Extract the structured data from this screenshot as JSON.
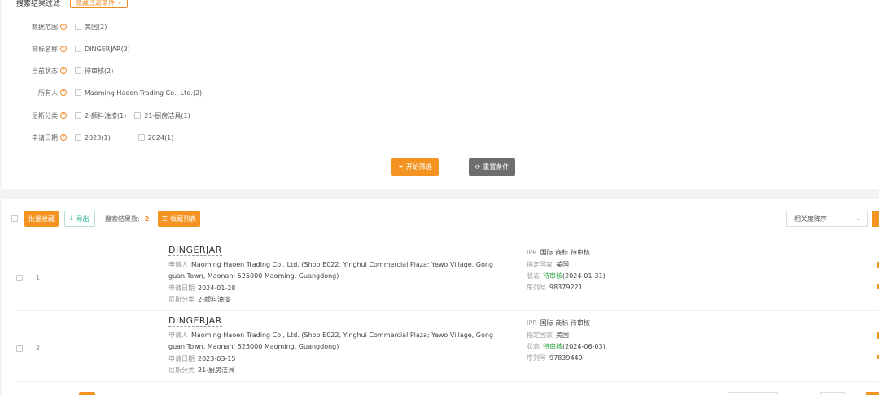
{
  "filter": {
    "title": "搜索结果过滤",
    "hide_label": "隐藏过滤条件",
    "rows": [
      {
        "label": "数据范围",
        "options": [
          "美国(2)"
        ]
      },
      {
        "label": "商标名称",
        "options": [
          "DINGERJAR(2)"
        ]
      },
      {
        "label": "当前状态",
        "options": [
          "待审核(2)"
        ]
      },
      {
        "label": "所有人",
        "options": [
          "Maoming Haoen Trading Co., Ltd.(2)"
        ]
      },
      {
        "label": "尼斯分类",
        "options": [
          "2-颜料油漆(1)",
          "21-厨房洁具(1)"
        ]
      },
      {
        "label": "申请日期",
        "options": [
          "2023(1)",
          "2024(1)"
        ]
      }
    ],
    "start_label": "开始筛选",
    "reset_label": "重置条件"
  },
  "toolbar": {
    "batch_collect": "批量收藏",
    "export": "导出",
    "result_count_label": "搜索结果数:",
    "result_count": "2",
    "collect_list": "收藏列表",
    "sort_value": "相关度降序"
  },
  "results": [
    {
      "index": "1",
      "name": "DINGERJAR",
      "applicant_label": "申请人",
      "applicant_line1": "Maoming Haoen Trading Co., Ltd. (Shop E022, Yinghui Commercial Plaza; Yewo Village, Gong",
      "applicant_line2": "guan Town, Maonan; 525000 Maoming, Guangdong)",
      "date_label": "申请日期",
      "date": "2024-01-28",
      "class_label": "尼斯分类",
      "class": "2-颜料油漆",
      "ipr_label": "IPR",
      "ipr": "国际 商标 待审核",
      "country_label": "指定国家",
      "country": "美国",
      "status_label": "状态",
      "status": "待审核",
      "status_date": "(2024-01-31)",
      "serial_label": "序列号",
      "serial": "98379221"
    },
    {
      "index": "2",
      "name": "DINGERJAR",
      "applicant_label": "申请人",
      "applicant_line1": "Maoming Haoen Trading Co., Ltd. (Shop E022, Yinghui Commercial Plaza; Yewo Village, Gong",
      "applicant_line2": "guan Town, Maonan; 525000 Maoming, Guangdong)",
      "date_label": "申请日期",
      "date": "2023-03-15",
      "class_label": "尼斯分类",
      "class": "21-厨房洁具",
      "ipr_label": "IPR",
      "ipr": "国际 商标 待审核",
      "country_label": "指定国家",
      "country": "美国",
      "status_label": "状态",
      "status": "待审核",
      "status_date": "(2024-06-03)",
      "serial_label": "序列号",
      "serial": "97839449"
    }
  ],
  "colors": {
    "accent": "#f39322",
    "teal": "#2bb39a",
    "status_green": "#28a745"
  }
}
